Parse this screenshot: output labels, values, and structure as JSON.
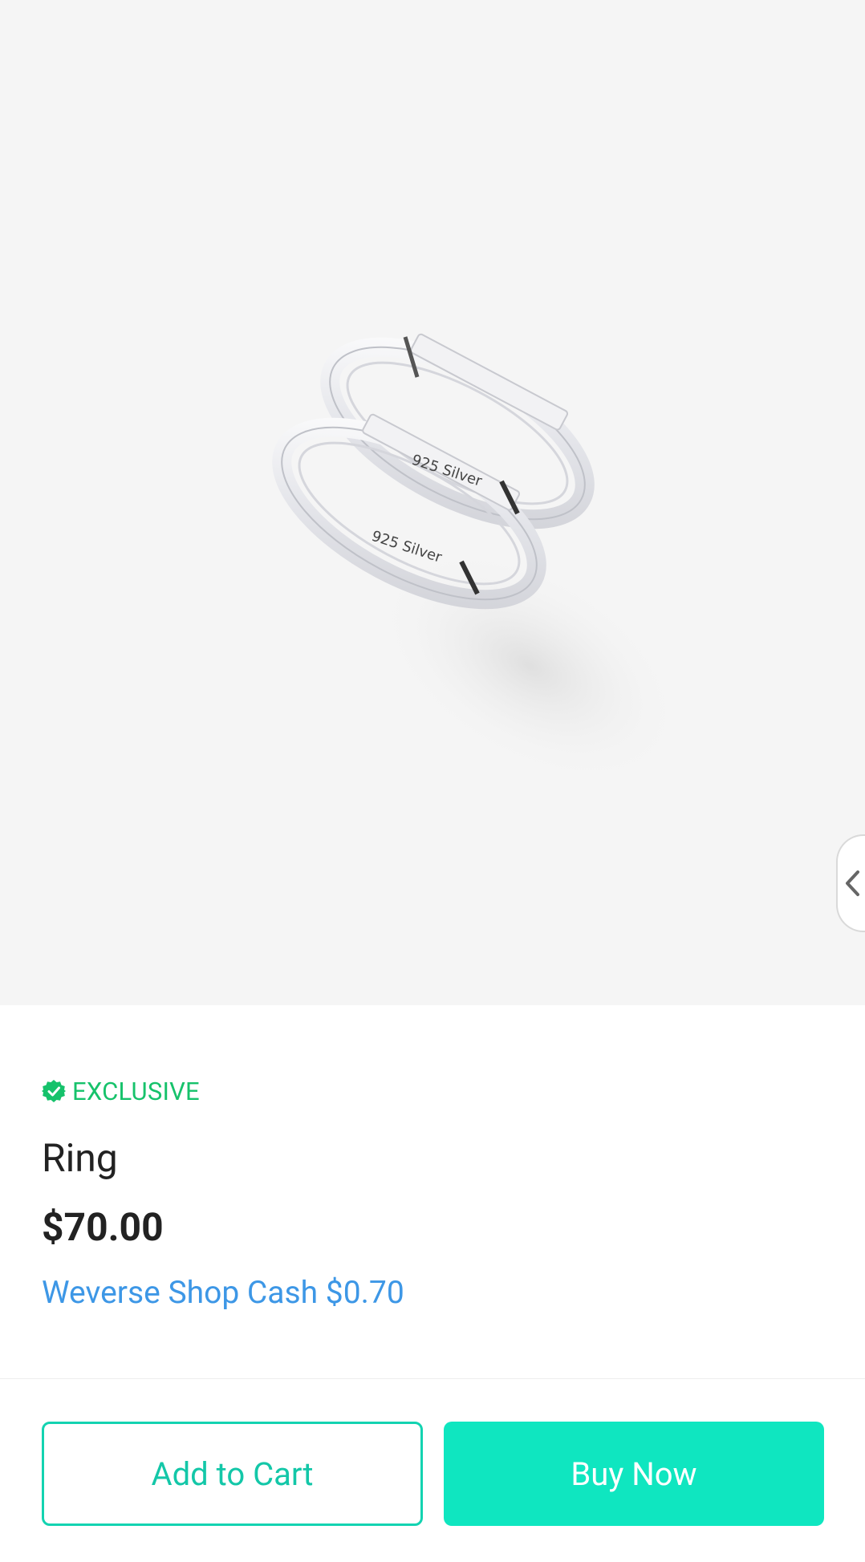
{
  "product": {
    "image_alt": "Two silver rings engraved 925 Silver",
    "engraving_text": "925 Silver",
    "badge": "EXCLUSIVE",
    "title": "Ring",
    "price": "$70.00",
    "cash_reward": "Weverse Shop Cash $0.70"
  },
  "actions": {
    "add_to_cart": "Add to Cart",
    "buy_now": "Buy Now"
  },
  "colors": {
    "accent": "#0fe6c0",
    "badge_green": "#16c26b",
    "cash_blue": "#3d97e6"
  },
  "icons": {
    "badge": "verified-badge-icon",
    "side_tab": "chevron-left-icon"
  }
}
